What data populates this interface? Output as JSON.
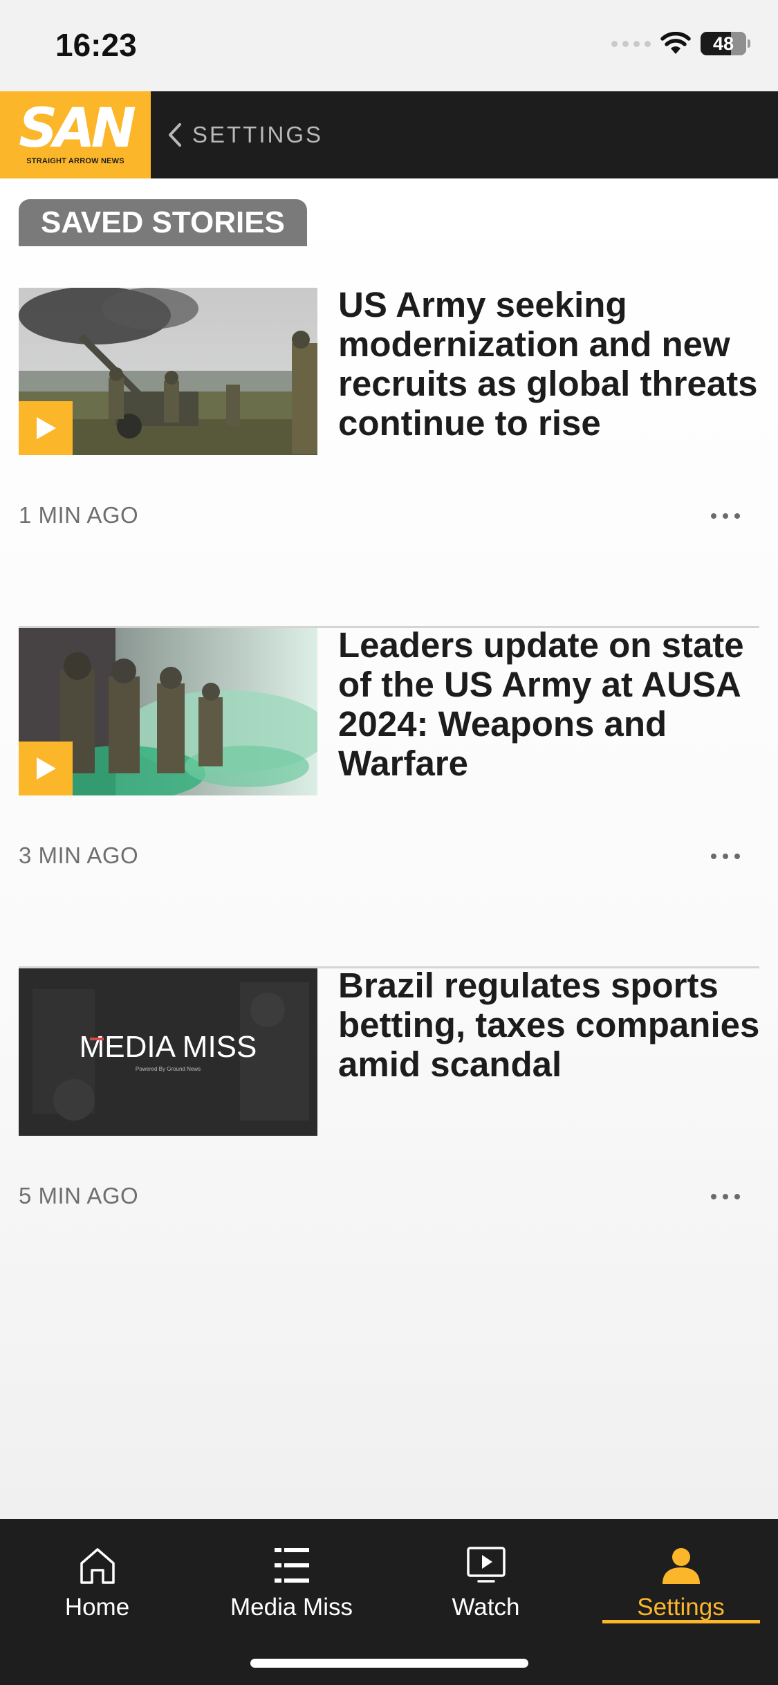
{
  "status_bar": {
    "time": "16:23",
    "battery": "48"
  },
  "header": {
    "logo_text": "SAN",
    "logo_subtitle": "STRAIGHT ARROW NEWS",
    "back_label": "SETTINGS"
  },
  "section": {
    "title": "SAVED STORIES"
  },
  "stories": [
    {
      "title": "US Army seeking modernization and new recruits as global threats continue to rise",
      "time": "1 MIN AGO",
      "has_video": true
    },
    {
      "title": "Leaders update on state of the US Army at AUSA 2024: Weapons and Warfare",
      "time": "3 MIN AGO",
      "has_video": true
    },
    {
      "title": "Brazil regulates sports betting, taxes companies amid scandal",
      "time": "5 MIN AGO",
      "has_video": false,
      "thumb_text": "MEDIA MISS",
      "thumb_subtext": "Powered By Ground News"
    }
  ],
  "tabs": [
    {
      "label": "Home",
      "icon": "home-icon",
      "active": false
    },
    {
      "label": "Media Miss",
      "icon": "list-icon",
      "active": false
    },
    {
      "label": "Watch",
      "icon": "play-screen-icon",
      "active": false
    },
    {
      "label": "Settings",
      "icon": "person-icon",
      "active": true
    }
  ],
  "colors": {
    "accent": "#fbb62a",
    "header_bg": "#1d1d1d",
    "pill_bg": "#7a7a7a"
  }
}
